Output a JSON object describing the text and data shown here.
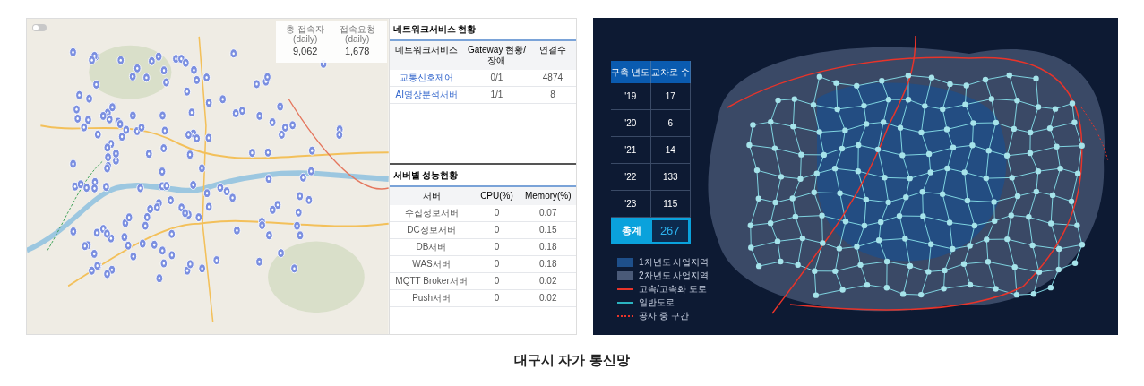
{
  "monitor_screen": {
    "toggle": {
      "on": false
    },
    "stats": [
      {
        "label": "총 접속자(daily)",
        "value": "9,062"
      },
      {
        "label": "접속요청(daily)",
        "value": "1,678"
      }
    ],
    "network_panel": {
      "title": "네트워크서비스 현황",
      "columns": [
        "네트워크서비스",
        "Gateway 현황/장애",
        "연결수"
      ],
      "rows": [
        {
          "cells": [
            "교통신호제어",
            "0/1",
            "4874"
          ]
        },
        {
          "cells": [
            "AI영상분석서버",
            "1/1",
            "8"
          ]
        }
      ]
    },
    "server_panel": {
      "title": "서버별 성능현황",
      "columns": [
        "서버",
        "CPU(%)",
        "Memory(%)"
      ],
      "rows": [
        {
          "cells": [
            "수집정보서버",
            "0",
            "0.07"
          ]
        },
        {
          "cells": [
            "DC정보서버",
            "0",
            "0.15"
          ]
        },
        {
          "cells": [
            "DB서버",
            "0",
            "0.18"
          ]
        },
        {
          "cells": [
            "WAS서버",
            "0",
            "0.18"
          ]
        },
        {
          "cells": [
            "MQTT Broker서버",
            "0",
            "0.02"
          ]
        },
        {
          "cells": [
            "Push서버",
            "0",
            "0.02"
          ]
        }
      ]
    }
  },
  "network_map": {
    "table": {
      "columns": [
        "구축 년도",
        "교차로 수"
      ],
      "rows": [
        {
          "cells": [
            "'19",
            "17"
          ]
        },
        {
          "cells": [
            "'20",
            "6"
          ]
        },
        {
          "cells": [
            "'21",
            "14"
          ]
        },
        {
          "cells": [
            "'22",
            "133"
          ]
        },
        {
          "cells": [
            "'23",
            "115"
          ]
        }
      ],
      "total": {
        "label": "총계",
        "value": "267"
      }
    },
    "legend": [
      {
        "kind": "area",
        "color": "#1e4f8a",
        "label": "1차년도 사업지역"
      },
      {
        "kind": "area",
        "color": "#4a5a78",
        "label": "2차년도 사업지역"
      },
      {
        "kind": "line",
        "color": "#e8342a",
        "label": "고속/고속화 도로"
      },
      {
        "kind": "line",
        "color": "#2bb3c0",
        "label": "일반도로"
      },
      {
        "kind": "dotted",
        "color": "#e8342a",
        "label": "공사 중 구간"
      }
    ]
  },
  "caption": "대구시 자가 통신망"
}
